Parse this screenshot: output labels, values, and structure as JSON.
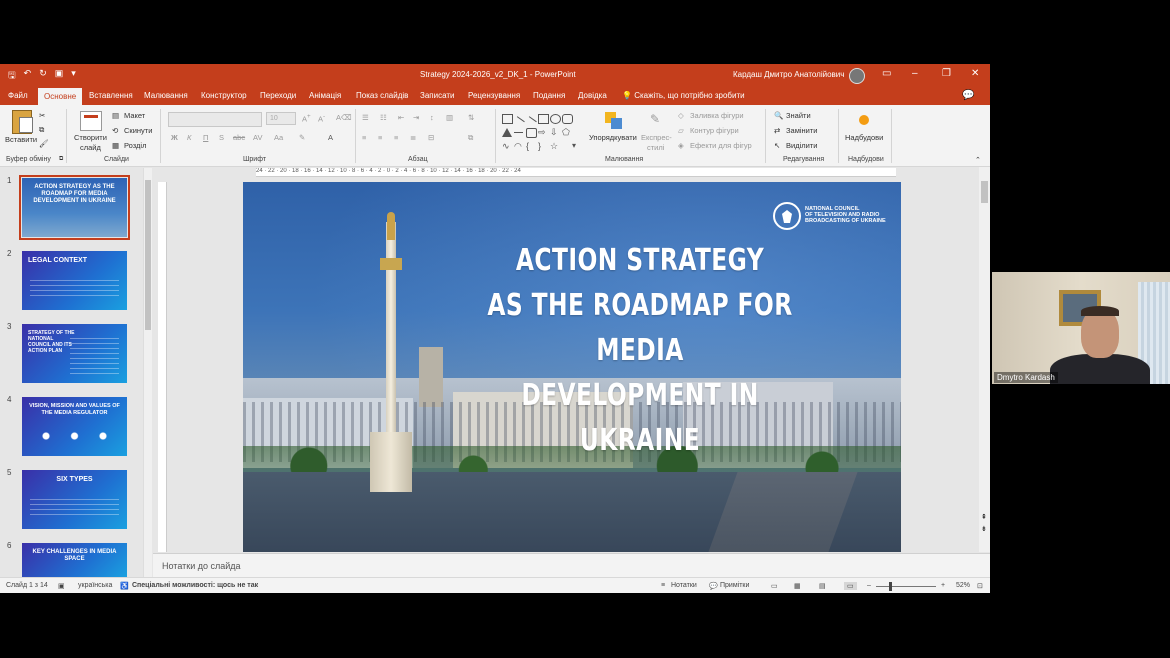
{
  "titlebar": {
    "document_title": "Strategy 2024-2026_v2_DK_1  -  PowerPoint",
    "user_name": "Кардаш Дмитро Анатолійович"
  },
  "tabs": [
    {
      "label": "Файл"
    },
    {
      "label": "Основне"
    },
    {
      "label": "Вставлення"
    },
    {
      "label": "Малювання"
    },
    {
      "label": "Конструктор"
    },
    {
      "label": "Переходи"
    },
    {
      "label": "Анімація"
    },
    {
      "label": "Показ слайдів"
    },
    {
      "label": "Записати"
    },
    {
      "label": "Рецензування"
    },
    {
      "label": "Подання"
    },
    {
      "label": "Довідка"
    }
  ],
  "tell_me": "Скажіть, що потрібно зробити",
  "ribbon": {
    "paste": "Вставити",
    "new_slide_1": "Створити",
    "new_slide_2": "слайд",
    "layout": "Макет",
    "reset": "Скинути",
    "section": "Розділ",
    "font_size": "10",
    "arrange": "Упорядкувати",
    "quick_styles_1": "Експрес-",
    "quick_styles_2": "стилі",
    "shape_fill": "Заливка фігури",
    "shape_outline": "Контур фігури",
    "shape_effects": "Ефекти для фігур",
    "find": "Знайти",
    "replace": "Замінити",
    "select": "Виділити",
    "addins": "Надбудови",
    "groups": {
      "clipboard": "Буфер обміну",
      "slides": "Слайди",
      "font": "Шрифт",
      "paragraph": "Абзац",
      "drawing": "Малювання",
      "editing": "Редагування",
      "addins": "Надбудови"
    }
  },
  "thumbnails": [
    {
      "num": "1",
      "title": "ACTION STRATEGY AS THE ROADMAP FOR MEDIA DEVELOPMENT IN UKRAINE"
    },
    {
      "num": "2",
      "title": "LEGAL CONTEXT"
    },
    {
      "num": "3",
      "title": "STRATEGY OF THE NATIONAL COUNCIL AND ITS ACTION PLAN"
    },
    {
      "num": "4",
      "title": "VISION, MISSION AND VALUES OF THE MEDIA REGULATOR"
    },
    {
      "num": "5",
      "title": "SIX TYPES"
    },
    {
      "num": "6",
      "title": "KEY CHALLENGES IN MEDIA SPACE"
    }
  ],
  "ruler_h": "24 · 22 · 20 · 18 · 16 · 14 · 12 · 10 · 8 · 6 · 4 · 2 · 0 · 2 · 4 · 6 · 8 · 10 · 12 · 14 · 16 · 18 · 20 · 22 · 24",
  "slide": {
    "title_line1": "ACTION STRATEGY",
    "title_line2": "AS THE ROADMAP FOR MEDIA",
    "title_line3": "DEVELOPMENT IN UKRAINE",
    "logo_text_1": "NATIONAL COUNCIL",
    "logo_text_2": "OF TELEVISION AND RADIO",
    "logo_text_3": "BROADCASTING OF UKRAINE"
  },
  "notes_placeholder": "Нотатки до слайда",
  "status": {
    "slide_counter": "Слайд 1 з 14",
    "language": "українська",
    "accessibility": "Спеціальні можливості: щось не так",
    "notes_btn": "Нотатки",
    "comments_btn": "Примітки",
    "zoom": "52%"
  },
  "webcam": {
    "participant_name": "Dmytro Kardash"
  },
  "colors": {
    "accent": "#c43e1c",
    "ribbon_bg": "#f3f3f3",
    "workspace_bg": "#e6e6e6"
  }
}
